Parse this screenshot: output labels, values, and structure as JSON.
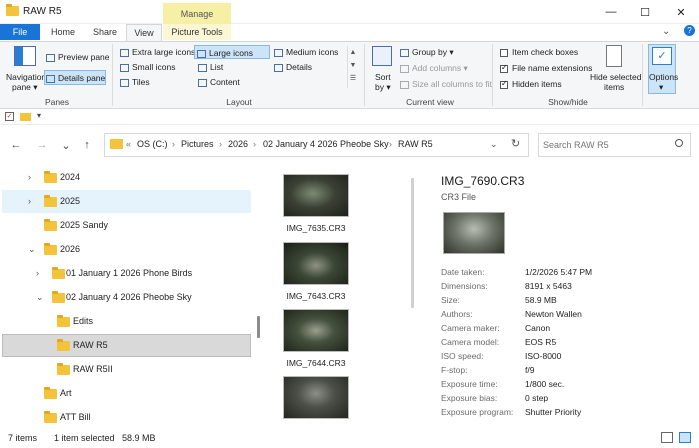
{
  "window": {
    "title": "RAW R5",
    "minimize_label": "—",
    "maximize_label": "☐",
    "close_label": "✕",
    "help_label": "?",
    "expand_ribbon_label": "⌄"
  },
  "ribbon_tabs": {
    "file": "File",
    "home": "Home",
    "share": "Share",
    "view": "View",
    "context_group": "Manage",
    "picture_tools": "Picture Tools"
  },
  "ribbon": {
    "panes": {
      "label": "Panes",
      "navigation_pane": "Navigation",
      "navigation_pane_2": "pane ▾",
      "preview_pane": "Preview pane",
      "details_pane": "Details pane"
    },
    "layout": {
      "label": "Layout",
      "extra_large_icons": "Extra large icons",
      "large_icons": "Large icons",
      "medium_icons": "Medium icons",
      "small_icons": "Small icons",
      "list": "List",
      "details": "Details",
      "tiles": "Tiles",
      "content": "Content"
    },
    "current_view": {
      "label": "Current view",
      "sort_by": "Sort",
      "sort_by_2": "by ▾",
      "group_by": "Group by ▾",
      "add_columns": "Add columns ▾",
      "size_all_columns": "Size all columns to fit"
    },
    "show_hide": {
      "label": "Show/hide",
      "item_check_boxes": "Item check boxes",
      "file_name_extensions": "File name extensions",
      "hidden_items": "Hidden items",
      "hide_selected_items": "Hide selected",
      "hide_selected_items_2": "items"
    },
    "options": {
      "label": "Options",
      "label_2": "▾"
    }
  },
  "toggles": {
    "item_check_boxes": false,
    "file_name_extensions": true,
    "hidden_items": true
  },
  "quick_access": {
    "dropdown": "▾"
  },
  "navigation": {
    "back": "←",
    "forward": "→",
    "recent": "⌄",
    "up": "↑",
    "refresh": "↻",
    "address_dropdown": "⌄"
  },
  "address": {
    "overflow": "«",
    "crumbs": [
      "OS (C:)",
      "Pictures",
      "2026",
      "02 January 4 2026 Pheobe Sky",
      "RAW R5"
    ],
    "separator": "›"
  },
  "search": {
    "placeholder": "Search RAW R5"
  },
  "nav_tree": [
    {
      "label": "2024",
      "indent": 0,
      "state": "collapsed"
    },
    {
      "label": "2025",
      "indent": 0,
      "state": "collapsed"
    },
    {
      "label": "2025 Sandy",
      "indent": 0,
      "state": "none"
    },
    {
      "label": "2026",
      "indent": 0,
      "state": "expanded"
    },
    {
      "label": "01 January 1 2026 Phone Birds",
      "indent": 1,
      "state": "collapsed"
    },
    {
      "label": "02 January 4 2026 Pheobe Sky",
      "indent": 1,
      "state": "expanded"
    },
    {
      "label": "Edits",
      "indent": 2,
      "state": "none"
    },
    {
      "label": "RAW R5",
      "indent": 2,
      "state": "none"
    },
    {
      "label": "RAW R5II",
      "indent": 2,
      "state": "none"
    },
    {
      "label": "Art",
      "indent": 0,
      "state": "none"
    },
    {
      "label": "ATT Bill",
      "indent": 0,
      "state": "none"
    }
  ],
  "files": [
    {
      "name": "IMG_7635.CR3"
    },
    {
      "name": "IMG_7643.CR3"
    },
    {
      "name": "IMG_7644.CR3"
    },
    {
      "name": ""
    }
  ],
  "details": {
    "filename": "IMG_7690.CR3",
    "filetype": "CR3 File",
    "properties": [
      {
        "key": "Date taken:",
        "value": "1/2/2026 5:47 PM"
      },
      {
        "key": "Dimensions:",
        "value": "8191 x 5463"
      },
      {
        "key": "Size:",
        "value": "58.9 MB"
      },
      {
        "key": "Authors:",
        "value": "Newton Wallen"
      },
      {
        "key": "Camera maker:",
        "value": "Canon"
      },
      {
        "key": "Camera model:",
        "value": "EOS R5"
      },
      {
        "key": "ISO speed:",
        "value": "ISO-8000"
      },
      {
        "key": "F-stop:",
        "value": "f/9"
      },
      {
        "key": "Exposure time:",
        "value": "1/800 sec."
      },
      {
        "key": "Exposure bias:",
        "value": "0 step"
      },
      {
        "key": "Exposure program:",
        "value": "Shutter Priority"
      }
    ]
  },
  "status": {
    "item_count": "7 items",
    "selection": "1 item selected",
    "selection_size": "58.9 MB"
  },
  "colors": {
    "file_tab": "#1a73d6",
    "manage_band": "#f6efa6",
    "selection": "#cce4f7",
    "folder": "#f3c33b"
  }
}
